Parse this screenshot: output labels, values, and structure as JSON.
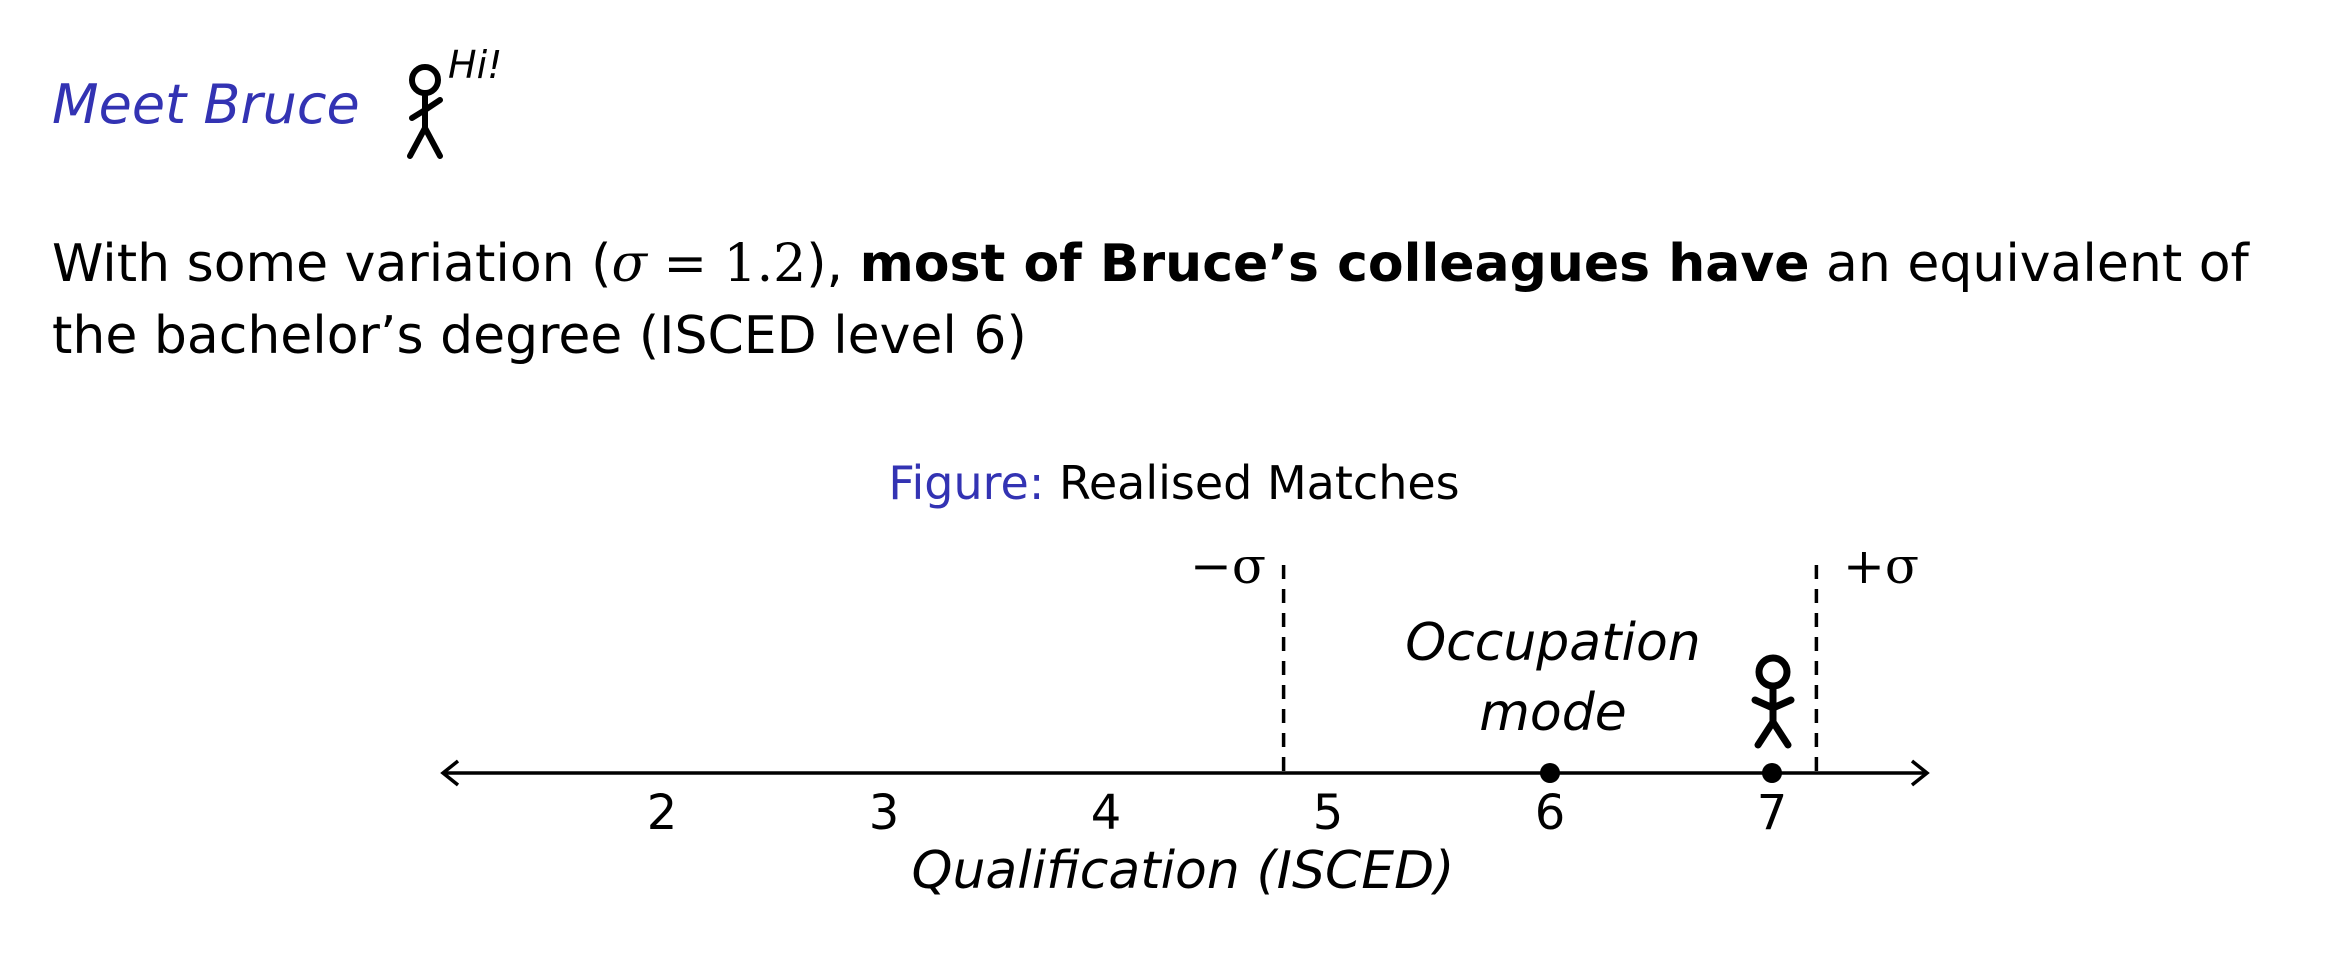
{
  "frame": {
    "title": "Meet Bruce",
    "greeting": "Hi!"
  },
  "text": {
    "before": "With some variation (",
    "sigma_symbol": "σ",
    "equals": " = 1.2",
    "after": "), ",
    "bold": "most of Bruce’s colleagues have",
    "rest": " an equivalent of the bachelor’s degree (ISCED level 6)"
  },
  "figure": {
    "caption_label": "Figure:",
    "caption_title": "Realised Matches",
    "minus_sigma": "−σ",
    "plus_sigma": "+σ",
    "mode_line1": "Occupation",
    "mode_line2": "mode"
  },
  "chart_data": {
    "type": "scatter",
    "xlabel": "Qualification (ISCED)",
    "ticks": [
      2,
      3,
      4,
      5,
      6,
      7
    ],
    "xlim": [
      1,
      7.7
    ],
    "points": [
      {
        "x": 6,
        "label": "Occupation mode"
      },
      {
        "x": 7,
        "label": "Bruce"
      }
    ],
    "mode": 6,
    "sigma": 1.2,
    "sigma_lines": [
      4.8,
      7.2
    ]
  }
}
